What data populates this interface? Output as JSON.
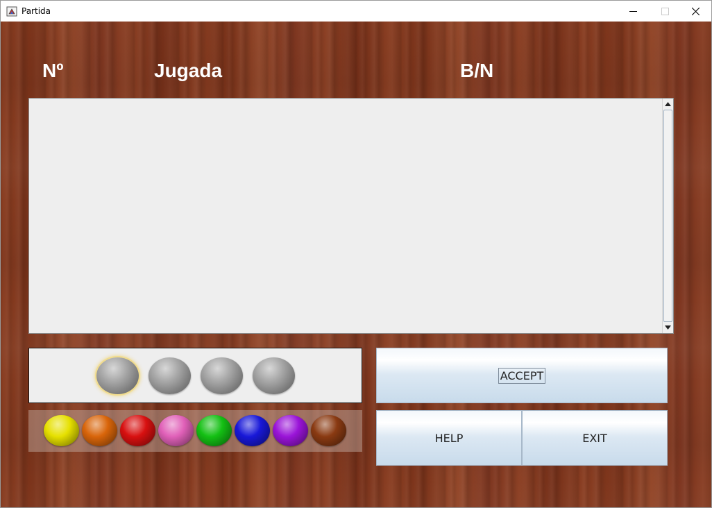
{
  "window": {
    "title": "Partida",
    "app_icon": "java-cup-icon",
    "controls": [
      "minimize-icon",
      "maximize-icon",
      "close-icon"
    ]
  },
  "headers": {
    "number": "Nº",
    "play": "Jugada",
    "black_white": "B/N"
  },
  "history": {
    "rows": []
  },
  "current_guess": {
    "pegs": [
      {
        "color": "#8c8c8c",
        "empty": true,
        "selected": true
      },
      {
        "color": "#8c8c8c",
        "empty": true,
        "selected": false
      },
      {
        "color": "#8c8c8c",
        "empty": true,
        "selected": false
      },
      {
        "color": "#8c8c8c",
        "empty": true,
        "selected": false
      }
    ]
  },
  "palette": {
    "colors": [
      {
        "name": "yellow",
        "hex": "#e6e000"
      },
      {
        "name": "orange",
        "hex": "#d9650a"
      },
      {
        "name": "red",
        "hex": "#d81010"
      },
      {
        "name": "pink",
        "hex": "#e060b8"
      },
      {
        "name": "green",
        "hex": "#14c014"
      },
      {
        "name": "blue",
        "hex": "#1818d8"
      },
      {
        "name": "purple",
        "hex": "#9a14d8"
      },
      {
        "name": "brown",
        "hex": "#8a3a12"
      }
    ]
  },
  "buttons": {
    "accept": "ACCEPT",
    "help": "HELP",
    "exit": "EXIT"
  }
}
